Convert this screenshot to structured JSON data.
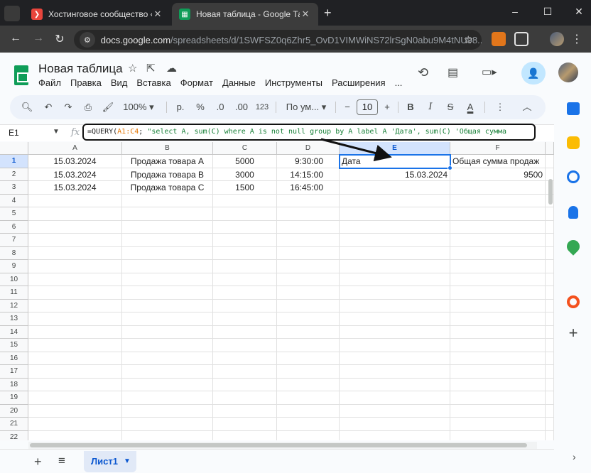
{
  "browser": {
    "tabs": [
      {
        "title": "Хостинговое сообщество «Tim",
        "active": false,
        "favicon_color": "#e8453c"
      },
      {
        "title": "Новая таблица - Google Табли",
        "active": true,
        "favicon_color": "#0f9d58"
      }
    ],
    "window_controls": {
      "minimize": "–",
      "maximize": "☐",
      "close": "✕"
    },
    "new_tab": "+",
    "url_host": "docs.google.com",
    "url_path": "/spreadsheets/d/1SWFSZ0q6Zhr5_OvD1VIMWiNS72lrSgN0abu9M4tNU98..."
  },
  "sheets": {
    "title": "Новая таблица",
    "menu": [
      "Файл",
      "Правка",
      "Вид",
      "Вставка",
      "Формат",
      "Данные",
      "Инструменты",
      "Расширения",
      "..."
    ],
    "toolbar": {
      "zoom": "100%",
      "currency": "р.",
      "percent": "%",
      "dec_decrease": ".0",
      "dec_increase": ".00",
      "format_123": "123",
      "font": "По ум...",
      "font_size": "10",
      "bold": "B",
      "italic": "I",
      "strike": "S",
      "text_color": "A"
    },
    "name_box": "E1",
    "fx": "fx",
    "formula": {
      "p1": "=QUERY(",
      "p2": "A1:C4",
      "p3": "; ",
      "p4": "\"select A, sum(C) where A is not null group by A label A 'Дата', sum(C) 'Общая сумма"
    },
    "columns": [
      "A",
      "B",
      "C",
      "D",
      "E",
      "F"
    ],
    "row_numbers": [
      "1",
      "2",
      "3",
      "4",
      "5",
      "6",
      "7",
      "8",
      "9",
      "10",
      "11",
      "12",
      "13",
      "14",
      "15",
      "16",
      "17",
      "18",
      "19",
      "20",
      "21",
      "22"
    ],
    "cells": {
      "r1": [
        "15.03.2024",
        "Продажа товара A",
        "5000",
        "9:30:00",
        "Дата",
        "Общая сумма продаж"
      ],
      "r2": [
        "15.03.2024",
        "Продажа товара B",
        "3000",
        "14:15:00",
        "15.03.2024",
        "9500"
      ],
      "r3": [
        "15.03.2024",
        "Продажа товара C",
        "1500",
        "16:45:00",
        "",
        ""
      ]
    },
    "sheet_tab": "Лист1",
    "add_sheet": "+",
    "all_sheets": "≡",
    "colors": {
      "accent": "#1a73e8",
      "toolbar_bg": "#edf2fa",
      "share_bg": "#c2e7ff",
      "formula_outline": "#111111"
    }
  }
}
